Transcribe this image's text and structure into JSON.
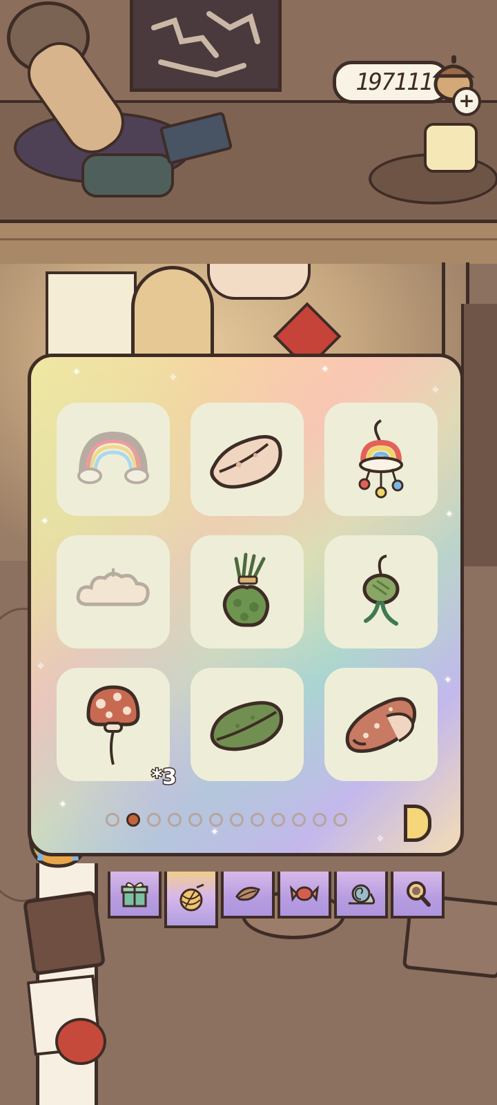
{
  "currency": {
    "value": "197111",
    "icon": "acorn-icon",
    "add_icon": "plus-icon"
  },
  "collection": {
    "items": [
      {
        "name": "rainbow-icon",
        "qty": ""
      },
      {
        "name": "tortilla-wrap-icon",
        "qty": ""
      },
      {
        "name": "rainbow-charm-icon",
        "qty": ""
      },
      {
        "name": "cloud-icon",
        "qty": ""
      },
      {
        "name": "herb-bundle-icon",
        "qty": ""
      },
      {
        "name": "green-charm-icon",
        "qty": ""
      },
      {
        "name": "mushroom-balloon-icon",
        "qty": "*3"
      },
      {
        "name": "green-wrap-icon",
        "qty": ""
      },
      {
        "name": "sausage-wrap-icon",
        "qty": ""
      }
    ],
    "page": {
      "current": 2,
      "total": 12
    }
  },
  "tabs": [
    {
      "icon": "gift-icon",
      "active": false
    },
    {
      "icon": "yarn-icon",
      "active": true
    },
    {
      "icon": "leaf-icon",
      "active": false
    },
    {
      "icon": "candy-icon",
      "active": false
    },
    {
      "icon": "snail-icon",
      "active": false
    },
    {
      "icon": "magnifier-icon",
      "active": false
    }
  ],
  "colors": {
    "outline": "#3e2c26",
    "slot": "#eeeed8",
    "active_dot": "#c2653b"
  }
}
